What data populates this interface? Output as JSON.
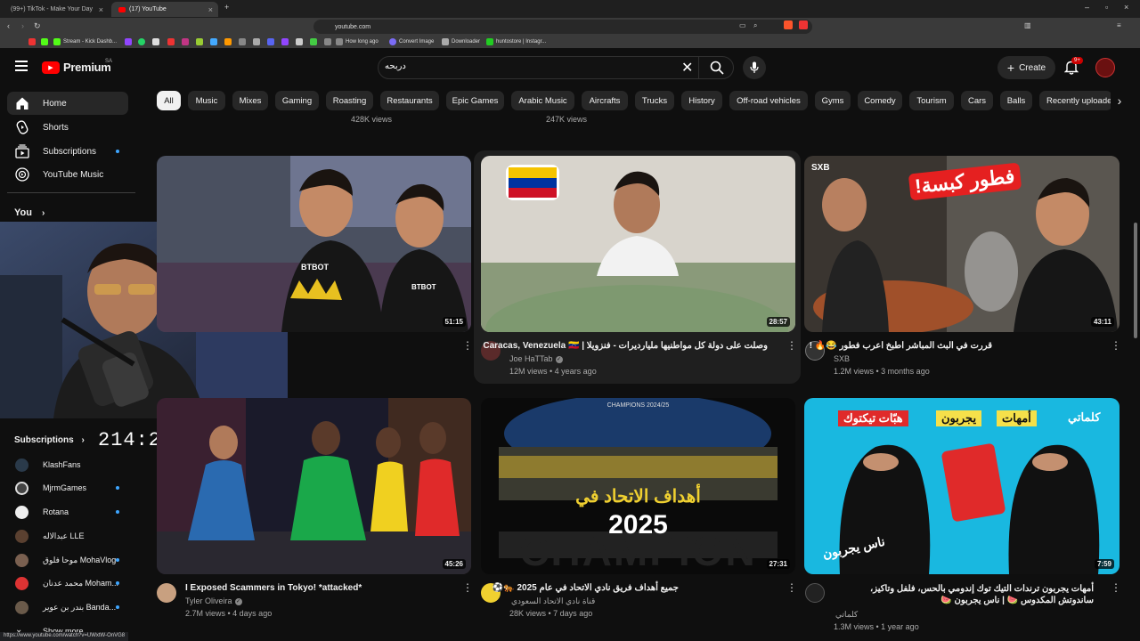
{
  "browser": {
    "tabs": [
      {
        "label": "(99+) TikTok - Make Your Day"
      },
      {
        "label": "(17) YouTube"
      }
    ],
    "url": "youtube.com",
    "bookmarks": [
      "Stream - Kick Dashb...",
      "How long ago",
      "Convert Image",
      "Downloader",
      "huntostore | Instagr..."
    ],
    "status_url": "https://www.youtube.com/watch?v=UWxtW-OnVG8"
  },
  "header": {
    "logo_text": "Premium",
    "region": "SA",
    "search_value": "دربحه",
    "create_label": "Create",
    "notif_badge": "9+"
  },
  "sidebar": {
    "items": [
      {
        "label": "Home"
      },
      {
        "label": "Shorts"
      },
      {
        "label": "Subscriptions"
      },
      {
        "label": "YouTube Music"
      }
    ],
    "you_label": "You",
    "subscriptions_heading": "Subscriptions",
    "subscriptions": [
      {
        "label": "KlashFans"
      },
      {
        "label": "MjrmGames"
      },
      {
        "label": "Rotana"
      },
      {
        "label": "عبدالاله LLE"
      },
      {
        "label": "موحا فلوق MohaVlog"
      },
      {
        "label": "محمد عدنان Moham..."
      },
      {
        "label": "بندر بن عوير Banda..."
      },
      {
        "label": "Show more"
      }
    ]
  },
  "chips": [
    "All",
    "Music",
    "Mixes",
    "Gaming",
    "Roasting",
    "Restaurants",
    "Epic Games",
    "Arabic Music",
    "Aircrafts",
    "Trucks",
    "History",
    "Off-road vehicles",
    "Gyms",
    "Comedy",
    "Tourism",
    "Cars",
    "Balls",
    "Recently uploaded"
  ],
  "prev_row_views": [
    "428K views",
    "247K views"
  ],
  "timer": "214:29:37",
  "videos": [
    {
      "title": "",
      "channel": "",
      "meta": "",
      "duration": "51:15"
    },
    {
      "title": "وصلت على دولة كل مواطنيها مليارديرات - فنزويلا | Caracas, Venezuela 🇻🇪",
      "channel": "Joe HaTTab",
      "meta": "12M views • 4 years ago",
      "duration": "28:57"
    },
    {
      "title": "قررت في البث المباشر اطبخ اعرب فطور 😂🔥 !",
      "channel": "SXB",
      "meta": "1.2M views • 3 months ago",
      "duration": "43:11"
    },
    {
      "title": "I Exposed Scammers in Tokyo! *attacked*",
      "channel": "Tyler Oliveira",
      "meta": "2.7M views • 4 days ago",
      "duration": "45:26"
    },
    {
      "title": "جميع أهداف فريق نادي الاتحاد في عام 2025 🐅⚽",
      "channel": "قناة نادي الاتحاد السعودي",
      "meta": "28K views • 7 days ago",
      "duration": "27:31"
    },
    {
      "title": "أمهات يجربون ترندات التيك توك إندومي بالحس، فلفل وتاكيز، ساندوتش المكدوس 🍉 | ناس يجربون 🍉",
      "channel": "كلماتي",
      "meta": "1.3M views • 1 year ago",
      "duration": "7:59"
    }
  ],
  "thumb_text": {
    "v1_caption": "BTBOT",
    "v3_arabic": "فطور كبسة!",
    "v3_brand": "SXB",
    "v5_arabic": "أهداف الاتحاد في",
    "v5_year": "2025",
    "v5_bg": "CHAMPION",
    "v5_top": "CHAMPIONS 2024/25",
    "v6_banner1": "أمهات",
    "v6_banner2": "يجربون",
    "v6_banner3": "هبّات تيكتوك",
    "v6_logo": "كلماتي",
    "v6_bottom": "ناس يجربون"
  },
  "colors": {
    "bg": "#0f0f0f",
    "accent": "#ff0000",
    "chip": "#272727",
    "blue_dot": "#3ea6ff"
  }
}
